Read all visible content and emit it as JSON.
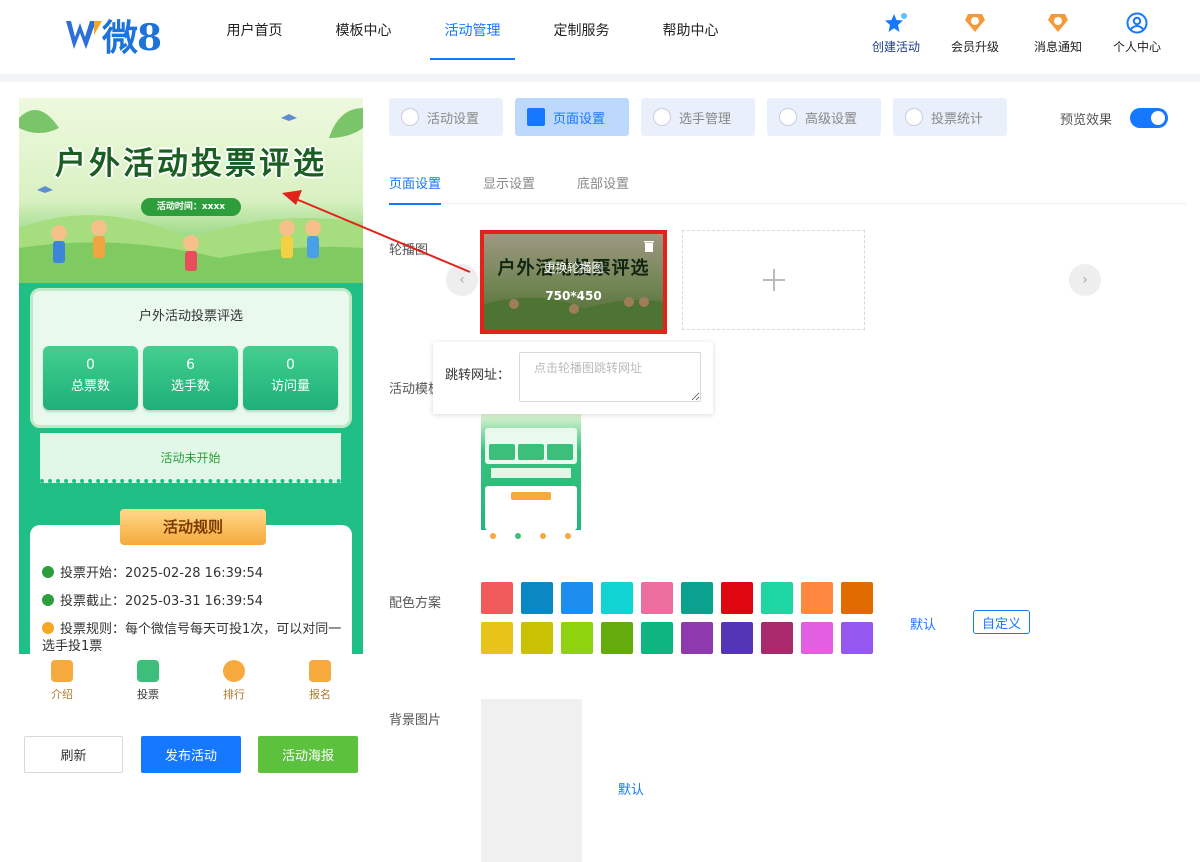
{
  "header": {
    "logo_text": "微8",
    "nav": [
      "用户首页",
      "模板中心",
      "活动管理",
      "定制服务",
      "帮助中心"
    ],
    "active_nav": 2,
    "right": [
      {
        "label": "创建活动",
        "icon": "star-icon"
      },
      {
        "label": "会员升级",
        "icon": "medal-icon"
      },
      {
        "label": "消息通知",
        "icon": "bell-icon"
      },
      {
        "label": "个人中心",
        "icon": "user-icon"
      }
    ]
  },
  "preview": {
    "title": "户外活动投票评选",
    "time_label": "活动时间：xxxx",
    "card_title": "户外活动投票评选",
    "stats": [
      {
        "value": "0",
        "label": "总票数"
      },
      {
        "value": "6",
        "label": "选手数"
      },
      {
        "value": "0",
        "label": "访问量"
      }
    ],
    "status": "活动未开始",
    "rules_title": "活动规则",
    "rules": [
      "投票开始：2025-02-28 16:39:54",
      "投票截止：2025-03-31 16:39:54",
      "投票规则：每个微信号每天可投1次，可以对同一选手投1票"
    ],
    "tabbar": [
      "介绍",
      "投票",
      "排行",
      "报名"
    ]
  },
  "actions": {
    "refresh": "刷新",
    "publish": "发布活动",
    "poster": "活动海报"
  },
  "settings": {
    "tabs": [
      "活动设置",
      "页面设置",
      "选手管理",
      "高级设置",
      "投票统计"
    ],
    "active_tab": 1,
    "preview_label": "预览效果",
    "preview_on": true,
    "subtabs": [
      "页面设置",
      "显示设置",
      "底部设置"
    ],
    "active_subtab": 0,
    "carousel_label": "轮播图",
    "carousel_image_title": "户外活动投票评选",
    "carousel_change": "更换轮播图",
    "carousel_size": "750*450",
    "jump_label": "跳转网址：",
    "jump_placeholder": "点击轮播图跳转网址",
    "template_label": "活动模板",
    "color_label": "配色方案",
    "colors": [
      "#f15b5c",
      "#0a88c4",
      "#1d8ef0",
      "#10d3d3",
      "#ec6e9e",
      "#0aa18f",
      "#e0060f",
      "#1ed6a4",
      "#ff8841",
      "#e06b00",
      "#e8c41a",
      "#c8c104",
      "#8fd20e",
      "#63ac0c",
      "#0fb57e",
      "#8e3aae",
      "#5335b6",
      "#a82a6c",
      "#e25fe2",
      "#9457ef"
    ],
    "default_label": "默认",
    "custom_label": "自定义",
    "bg_label": "背景图片",
    "bg_default": "默认"
  }
}
